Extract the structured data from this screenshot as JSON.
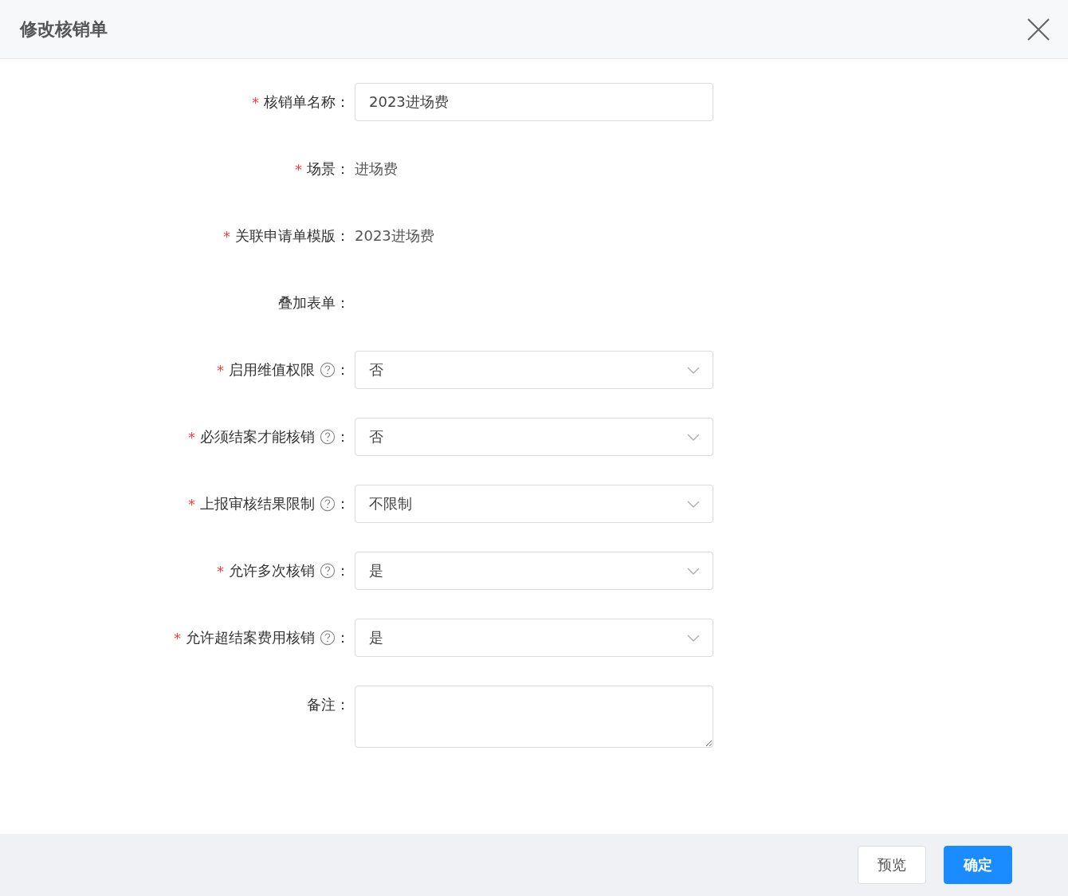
{
  "dialog": {
    "title": "修改核销单"
  },
  "fields": [
    {
      "kind": "input",
      "label": "核销单名称",
      "required": true,
      "help": false,
      "value": "2023进场费"
    },
    {
      "kind": "text",
      "label": "场景",
      "required": true,
      "help": false,
      "value": "进场费"
    },
    {
      "kind": "text",
      "label": "关联申请单模版",
      "required": true,
      "help": false,
      "value": "2023进场费"
    },
    {
      "kind": "empty",
      "label": "叠加表单",
      "required": false,
      "help": false
    },
    {
      "kind": "select",
      "label": "启用维值权限",
      "required": true,
      "help": true,
      "value": "否"
    },
    {
      "kind": "select",
      "label": "必须结案才能核销",
      "required": true,
      "help": true,
      "value": "否"
    },
    {
      "kind": "select",
      "label": "上报审核结果限制",
      "required": true,
      "help": true,
      "value": "不限制"
    },
    {
      "kind": "select",
      "label": "允许多次核销",
      "required": true,
      "help": true,
      "value": "是"
    },
    {
      "kind": "select",
      "label": "允许超结案费用核销",
      "required": true,
      "help": true,
      "value": "是"
    },
    {
      "kind": "textarea",
      "label": "备注",
      "required": false,
      "help": false
    }
  ],
  "colon": "：",
  "required_mark": "*",
  "buttons": [
    {
      "label": "预览",
      "primary": false
    },
    {
      "label": "确定",
      "primary": true
    }
  ]
}
